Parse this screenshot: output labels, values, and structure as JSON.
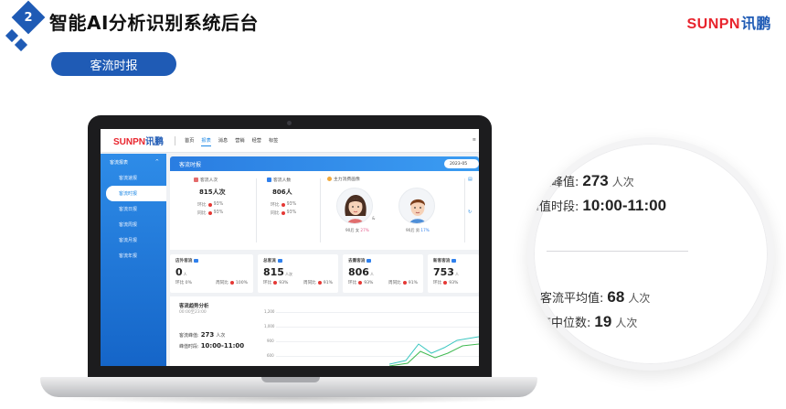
{
  "slide": {
    "step_number": "2",
    "title": "智能AI分析识别系统后台",
    "brand_latin": "SUNPN",
    "brand_cn": "讯鹏",
    "section_label": "客流时报"
  },
  "app": {
    "logo_latin": "SUNPN",
    "logo_cn": "讯鹏",
    "nav": [
      "首页",
      "报表",
      "消息",
      "营销",
      "经营",
      "标签"
    ],
    "active_nav": "报表",
    "top_right": "≡"
  },
  "sidebar": {
    "header": "客流报表",
    "caret": "^",
    "items": [
      "客流速报",
      "客流时报",
      "客流日报",
      "客流周报",
      "客流月报",
      "客流年报"
    ],
    "active_item": "客流时报"
  },
  "report": {
    "banner_title": "客流时报",
    "date": "2023-05",
    "visits": {
      "label": "客流人次",
      "value": "815人次",
      "ring_label": "环比",
      "ring_value": "93%",
      "yoy_label": "同比",
      "yoy_value": "93%"
    },
    "people": {
      "label": "客流人数",
      "value": "806人",
      "ring_label": "环比",
      "ring_value": "93%",
      "yoy_label": "同比",
      "yoy_value": "93%"
    },
    "group_title": "主力消费画像",
    "female_caption_a": "90后",
    "female_caption_b": "女",
    "female_pct": "27%",
    "male_caption_a": "90后",
    "male_caption_b": "男",
    "male_pct": "17%",
    "mid_char": "&"
  },
  "stats": [
    {
      "title": "店外客流",
      "value": "0",
      "unit": "人",
      "left_label": "环比 0%",
      "right_label": "周同比",
      "right_value": "100%"
    },
    {
      "title": "总客流",
      "value": "815",
      "unit": "人次",
      "left_label": "环比",
      "left_value": "93%",
      "right_label": "周同比",
      "right_value": "91%"
    },
    {
      "title": "去重客流",
      "value": "806",
      "unit": "人",
      "left_label": "环比",
      "left_value": "93%",
      "right_label": "周同比",
      "right_value": "91%"
    },
    {
      "title": "新客客流",
      "value": "753",
      "unit": "人",
      "left_label": "环比",
      "left_value": "93%",
      "right_label": "",
      "right_value": ""
    }
  ],
  "trend": {
    "title": "客流趋势分析",
    "range": "00:00至23:00",
    "peak_label": "客流峰值:",
    "peak_value": "273",
    "peak_unit": "人次",
    "peak_time_label": "峰值时段:",
    "peak_time_value": "10:00-11:00",
    "y_ticks": [
      "1,200",
      "1,000",
      "900",
      "600"
    ]
  },
  "magnifier": {
    "peak_label": "客流峰值:",
    "peak_value": "273",
    "peak_unit": "人次",
    "peak_time_label": "峰值时段:",
    "peak_time_value": "10:00-11:00",
    "avg_label": "客流平均值:",
    "avg_value": "68",
    "avg_unit": "人次",
    "median_label": "客流中位数:",
    "median_value": "19",
    "median_unit": "人次"
  },
  "colors": {
    "brand_blue": "#1f5bb5",
    "brand_red": "#e8242d",
    "accent_blue": "#1e88e5",
    "down_red": "#e53935"
  }
}
